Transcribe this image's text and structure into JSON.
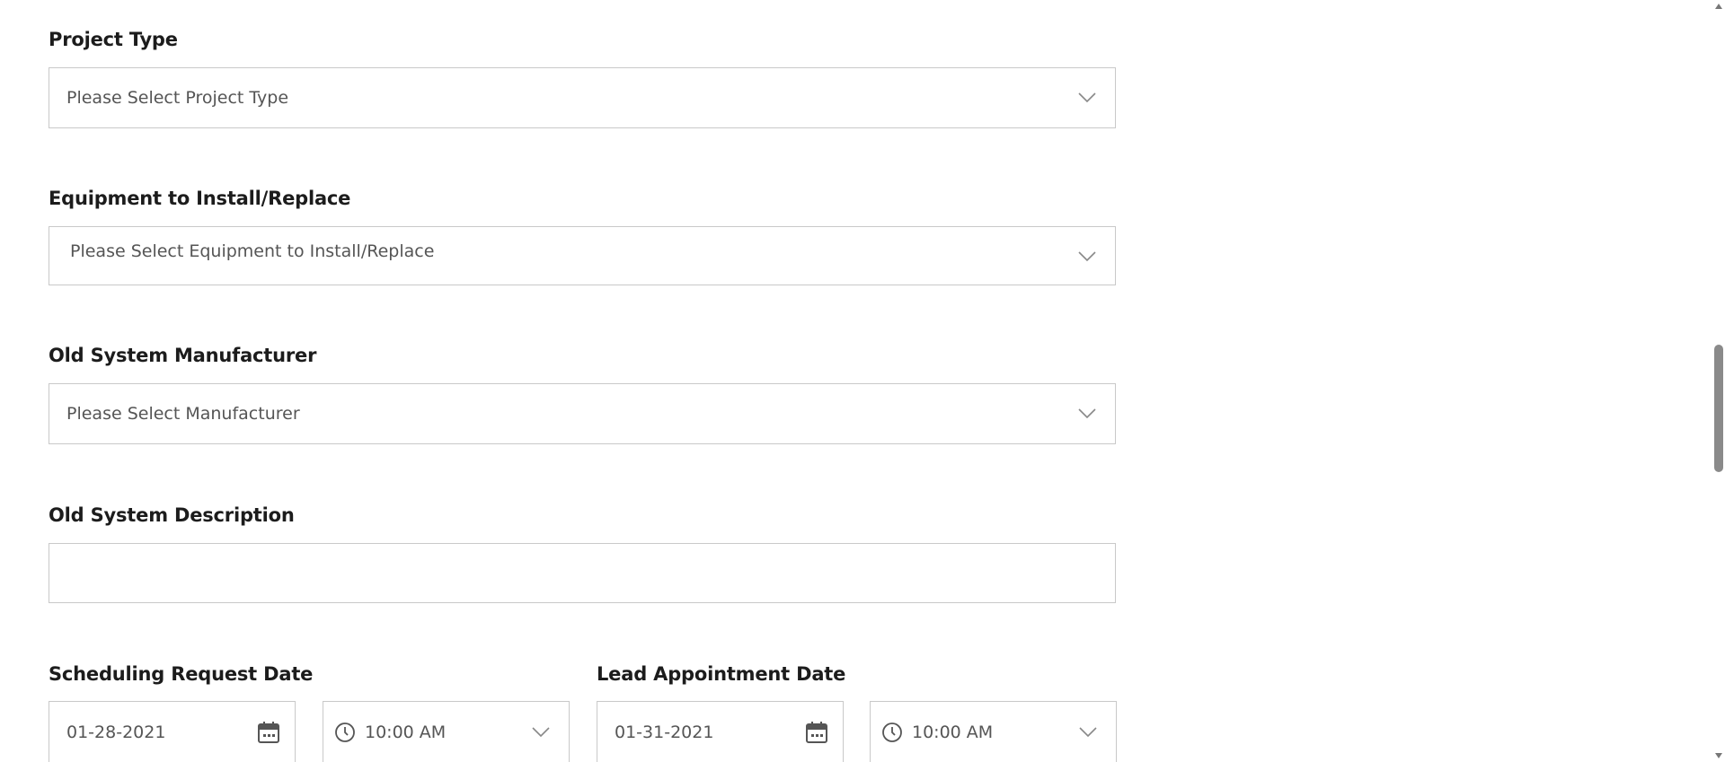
{
  "form": {
    "project_type": {
      "label": "Project Type",
      "placeholder": "Please Select Project Type"
    },
    "equipment": {
      "label": "Equipment to Install/Replace",
      "placeholder": "Please Select Equipment to Install/Replace"
    },
    "manufacturer": {
      "label": "Old System Manufacturer",
      "placeholder": "Please Select Manufacturer"
    },
    "description": {
      "label": "Old System Description",
      "value": ""
    },
    "scheduling": {
      "label": "Scheduling Request Date",
      "date": "01-28-2021",
      "time": "10:00 AM"
    },
    "lead_appointment": {
      "label": "Lead Appointment Date",
      "date": "01-31-2021",
      "time": "10:00 AM"
    }
  },
  "icons": {
    "dropdown": "chevron-down-icon",
    "date": "calendar-icon",
    "time": "clock-icon"
  },
  "colors": {
    "border": "#c9c9c9",
    "label_text": "#1c1c1c",
    "value_text": "#555555",
    "scrollbar_thumb": "#8a8a8a"
  }
}
